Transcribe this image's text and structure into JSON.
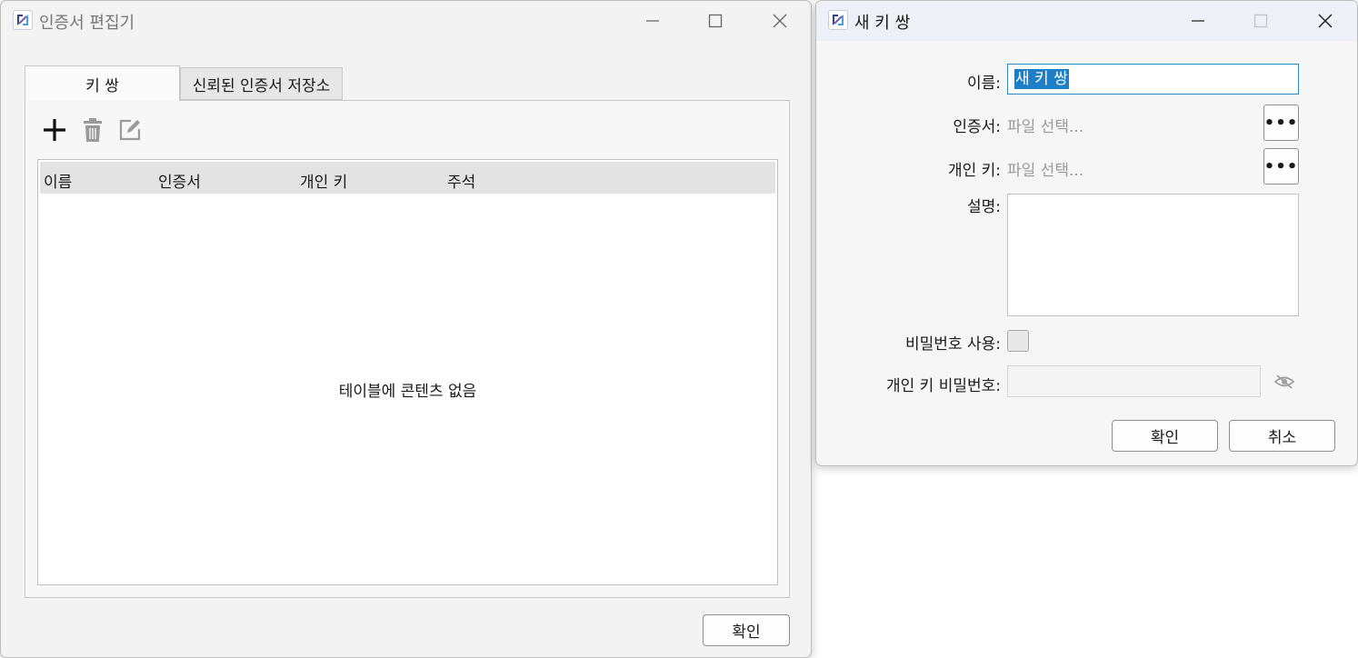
{
  "main_window": {
    "title": "인증서 편집기",
    "tabs": [
      {
        "label": "키 쌍",
        "active": true
      },
      {
        "label": "신뢰된 인증서 저장소",
        "active": false
      }
    ],
    "toolbar": {
      "add_icon": "plus-icon",
      "delete_icon": "trash-icon",
      "edit_icon": "edit-icon"
    },
    "table": {
      "columns": [
        "이름",
        "인증서",
        "개인 키",
        "주석"
      ],
      "rows": [],
      "empty_message": "테이블에 콘텐츠 없음"
    },
    "ok_label": "확인"
  },
  "dialog": {
    "title": "새 키 쌍",
    "name": {
      "label": "이름:",
      "value": "새 키 쌍"
    },
    "certificate": {
      "label": "인증서:",
      "placeholder": "파일 선택...",
      "browse_label": "•••"
    },
    "private_key": {
      "label": "개인 키:",
      "placeholder": "파일 선택...",
      "browse_label": "•••"
    },
    "description": {
      "label": "설명:",
      "value": ""
    },
    "use_password": {
      "label": "비밀번호 사용:",
      "checked": false
    },
    "key_password": {
      "label": "개인 키 비밀번호:",
      "value": "",
      "visibility_icon": "eye-slash-icon"
    },
    "ok_label": "확인",
    "cancel_label": "취소"
  },
  "colors": {
    "accent": "#2f89c8",
    "selection": "#1c7fc7"
  }
}
